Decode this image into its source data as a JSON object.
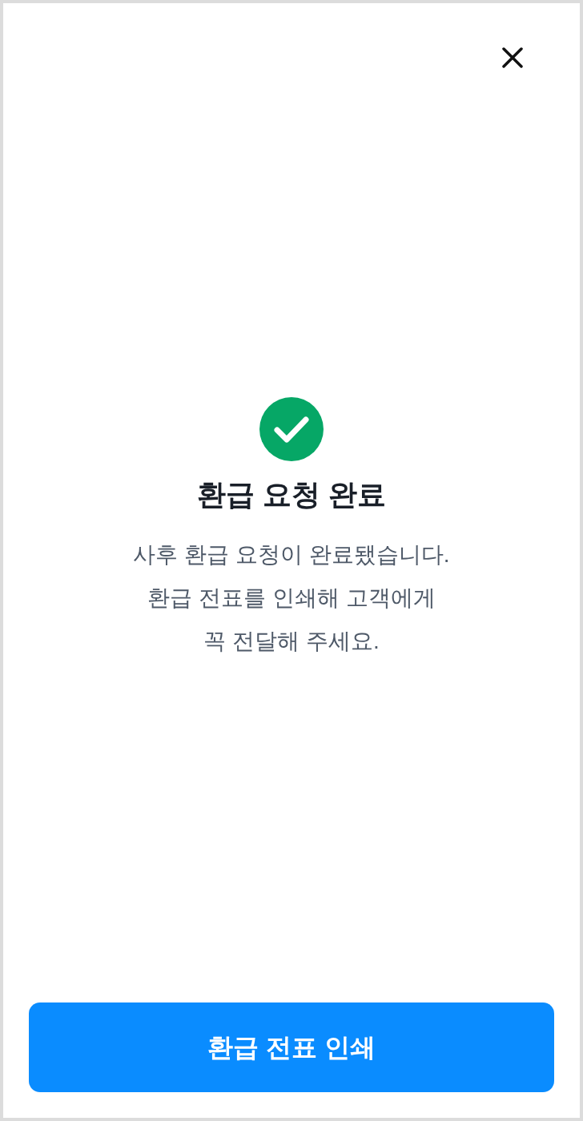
{
  "title": "환급 요청 완료",
  "message": [
    "사후 환급 요청이 완료됐습니다.",
    "환급 전표를 인쇄해 고객에게",
    "꼭 전달해 주세요."
  ],
  "primary_button": "환급 전표 인쇄"
}
